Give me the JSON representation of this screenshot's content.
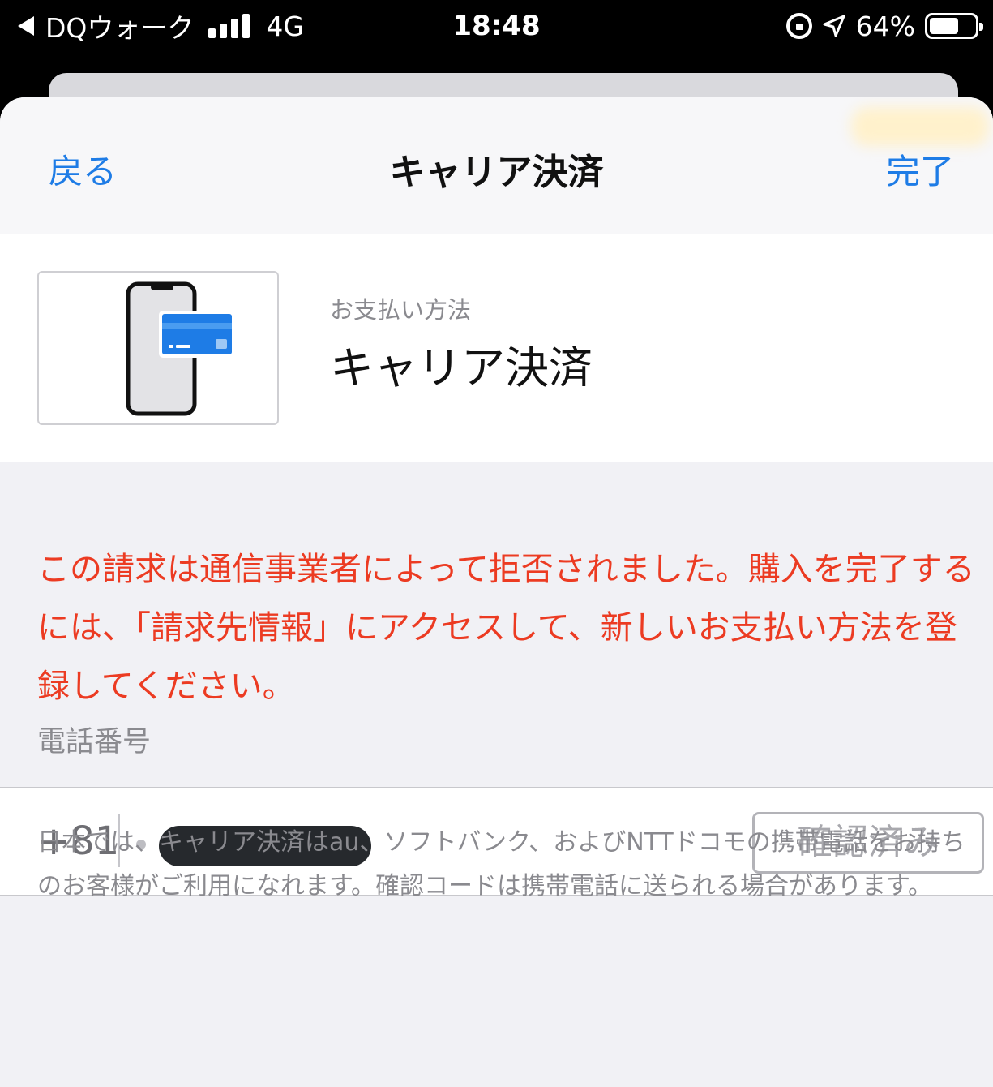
{
  "status_bar": {
    "back_app": "DQウォーク",
    "network": "4G",
    "time": "18:48",
    "battery": "64%",
    "battery_level": 0.64,
    "icons": [
      "back-triangle-icon",
      "signal-bars-icon",
      "orientation-lock-icon",
      "location-arrow-icon",
      "battery-icon"
    ]
  },
  "nav": {
    "back_label": "戻る",
    "title": "キャリア決済",
    "done_label": "完了"
  },
  "payment_method": {
    "caption": "お支払い方法",
    "name": "キャリア決済",
    "icon": "phone-card-icon"
  },
  "error_message": "この請求は通信事業者によって拒否されました。購入を完了するには、「請求先情報」にアクセスして、新しいお支払い方法を登録してください。",
  "phone": {
    "label": "電話番号",
    "country_code": "+81",
    "verified_label": "確認済み"
  },
  "footer_note": "日本では、キャリア決済はau、ソフトバンク、およびNTTドコモの携帯電話をお持ちのお客様がご利用になれます。確認コードは携帯電話に送られる場合があります。",
  "colors": {
    "accent": "#1e7ce6",
    "error": "#ec3b22",
    "secondary_text": "#8a8a8f",
    "card_blue": "#1e7ce6"
  }
}
